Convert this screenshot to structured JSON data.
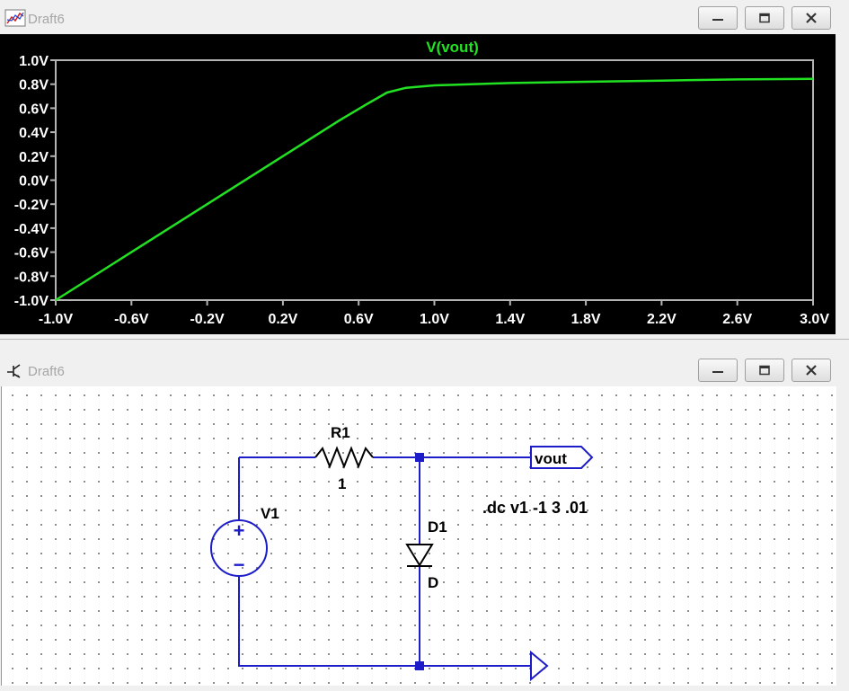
{
  "colors": {
    "plot_background": "#000000",
    "trace": "#22e022",
    "axis": "#b4b4b4",
    "tick_label": "#ffffff",
    "wire": "#1c1cc8",
    "component_text": "#000000",
    "junction": "#1c1cc8"
  },
  "plot_window": {
    "title": "Draft6",
    "icon": "waveform-icon",
    "buttons": {
      "minimize": "minimize-icon",
      "maximize": "maximize-icon",
      "close": "close-icon"
    }
  },
  "schematic_window": {
    "title": "Draft6",
    "icon": "schematic-icon",
    "buttons": {
      "minimize": "minimize-icon",
      "maximize": "maximize-icon",
      "close": "close-icon"
    },
    "components": {
      "resistor": {
        "name": "R1",
        "value": "1"
      },
      "source": {
        "name": "V1",
        "plus": "+",
        "minus": "−"
      },
      "diode": {
        "name": "D1",
        "model": "D"
      },
      "net_label": "vout",
      "directive": ".dc v1 -1 3 .01"
    }
  },
  "chart_data": {
    "type": "line",
    "title": "V(vout)",
    "xlabel": "",
    "ylabel": "",
    "xlim": [
      -1.0,
      3.0
    ],
    "ylim": [
      -1.0,
      1.0
    ],
    "x_ticks": [
      "-1.0V",
      "-0.6V",
      "-0.2V",
      "0.2V",
      "0.6V",
      "1.0V",
      "1.4V",
      "1.8V",
      "2.2V",
      "2.6V",
      "3.0V"
    ],
    "x_tick_values": [
      -1.0,
      -0.6,
      -0.2,
      0.2,
      0.6,
      1.0,
      1.4,
      1.8,
      2.2,
      2.6,
      3.0
    ],
    "y_ticks": [
      "1.0V",
      "0.8V",
      "0.6V",
      "0.4V",
      "0.2V",
      "0.0V",
      "-0.2V",
      "-0.4V",
      "-0.6V",
      "-0.8V",
      "-1.0V"
    ],
    "y_tick_values": [
      1.0,
      0.8,
      0.6,
      0.4,
      0.2,
      0.0,
      -0.2,
      -0.4,
      -0.6,
      -0.8,
      -1.0
    ],
    "grid": false,
    "series": [
      {
        "name": "V(vout)",
        "x": [
          -1.0,
          -0.6,
          -0.2,
          0.2,
          0.5,
          0.65,
          0.75,
          0.85,
          1.0,
          1.4,
          1.8,
          2.2,
          2.6,
          3.0
        ],
        "y": [
          -1.0,
          -0.6,
          -0.2,
          0.2,
          0.5,
          0.64,
          0.73,
          0.77,
          0.79,
          0.81,
          0.82,
          0.83,
          0.84,
          0.845
        ]
      }
    ]
  }
}
